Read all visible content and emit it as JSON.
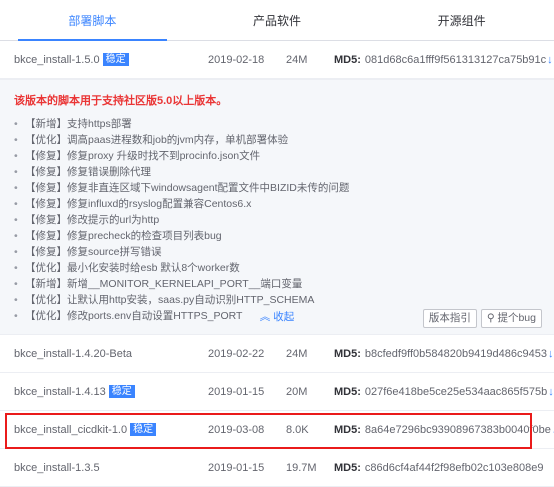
{
  "tabs": [
    "部署脚本",
    "产品软件",
    "开源组件"
  ],
  "md5_label": "MD5:",
  "download_icon": "↓",
  "rows_top": [
    {
      "name": "bkce_install-1.5.0",
      "badge": "稳定",
      "date": "2019-02-18",
      "size": "24M",
      "md5": "081d68c6a1fff9f561313127ca75b91c"
    }
  ],
  "notes": {
    "title": "该版本的脚本用于支持社区版5.0以上版本。",
    "items": [
      "【新增】支持https部署",
      "【优化】调高paas进程数和job的jvm内存，单机部署体验",
      "【修复】修复proxy 升级时找不到procinfo.json文件",
      "【修复】修复错误删除代理",
      "【修复】修复非直连区域下windowsagent配置文件中BIZID未传的问题",
      "【修复】修复influxd的rsyslog配置兼容Centos6.x",
      "【修复】修改提示的url为http",
      "【修复】修复precheck的检查项目列表bug",
      "【修复】修复source拼写错误",
      "【优化】最小化安装时给esb 默认8个worker数",
      "【新增】新增__MONITOR_KERNELAPI_PORT__端口变量",
      "【优化】让默认用http安装，saas.py自动识别HTTP_SCHEMA",
      "【优化】修改ports.env自动设置HTTPS_PORT"
    ],
    "collapse": "收起",
    "btn_guide": "版本指引",
    "btn_bug": "提个bug"
  },
  "rows_bottom": [
    {
      "name": "bkce_install-1.4.20-Beta",
      "badge": "",
      "date": "2019-02-22",
      "size": "24M",
      "md5": "b8cfedf9ff0b584820b9419d486c9453"
    },
    {
      "name": "bkce_install-1.4.13",
      "badge": "稳定",
      "date": "2019-01-15",
      "size": "20M",
      "md5": "027f6e418be5ce25e534aac865f575b"
    },
    {
      "name": "bkce_install_cicdkit-1.0",
      "badge": "稳定",
      "date": "2019-03-08",
      "size": "8.0K",
      "md5": "8a64e7296bc93908967383b0040f0be"
    },
    {
      "name": "bkce_install-1.3.5",
      "badge": "",
      "date": "2019-01-15",
      "size": "19.7M",
      "md5": "c86d6cf4af44f2f98efb02c103e808e9"
    }
  ]
}
